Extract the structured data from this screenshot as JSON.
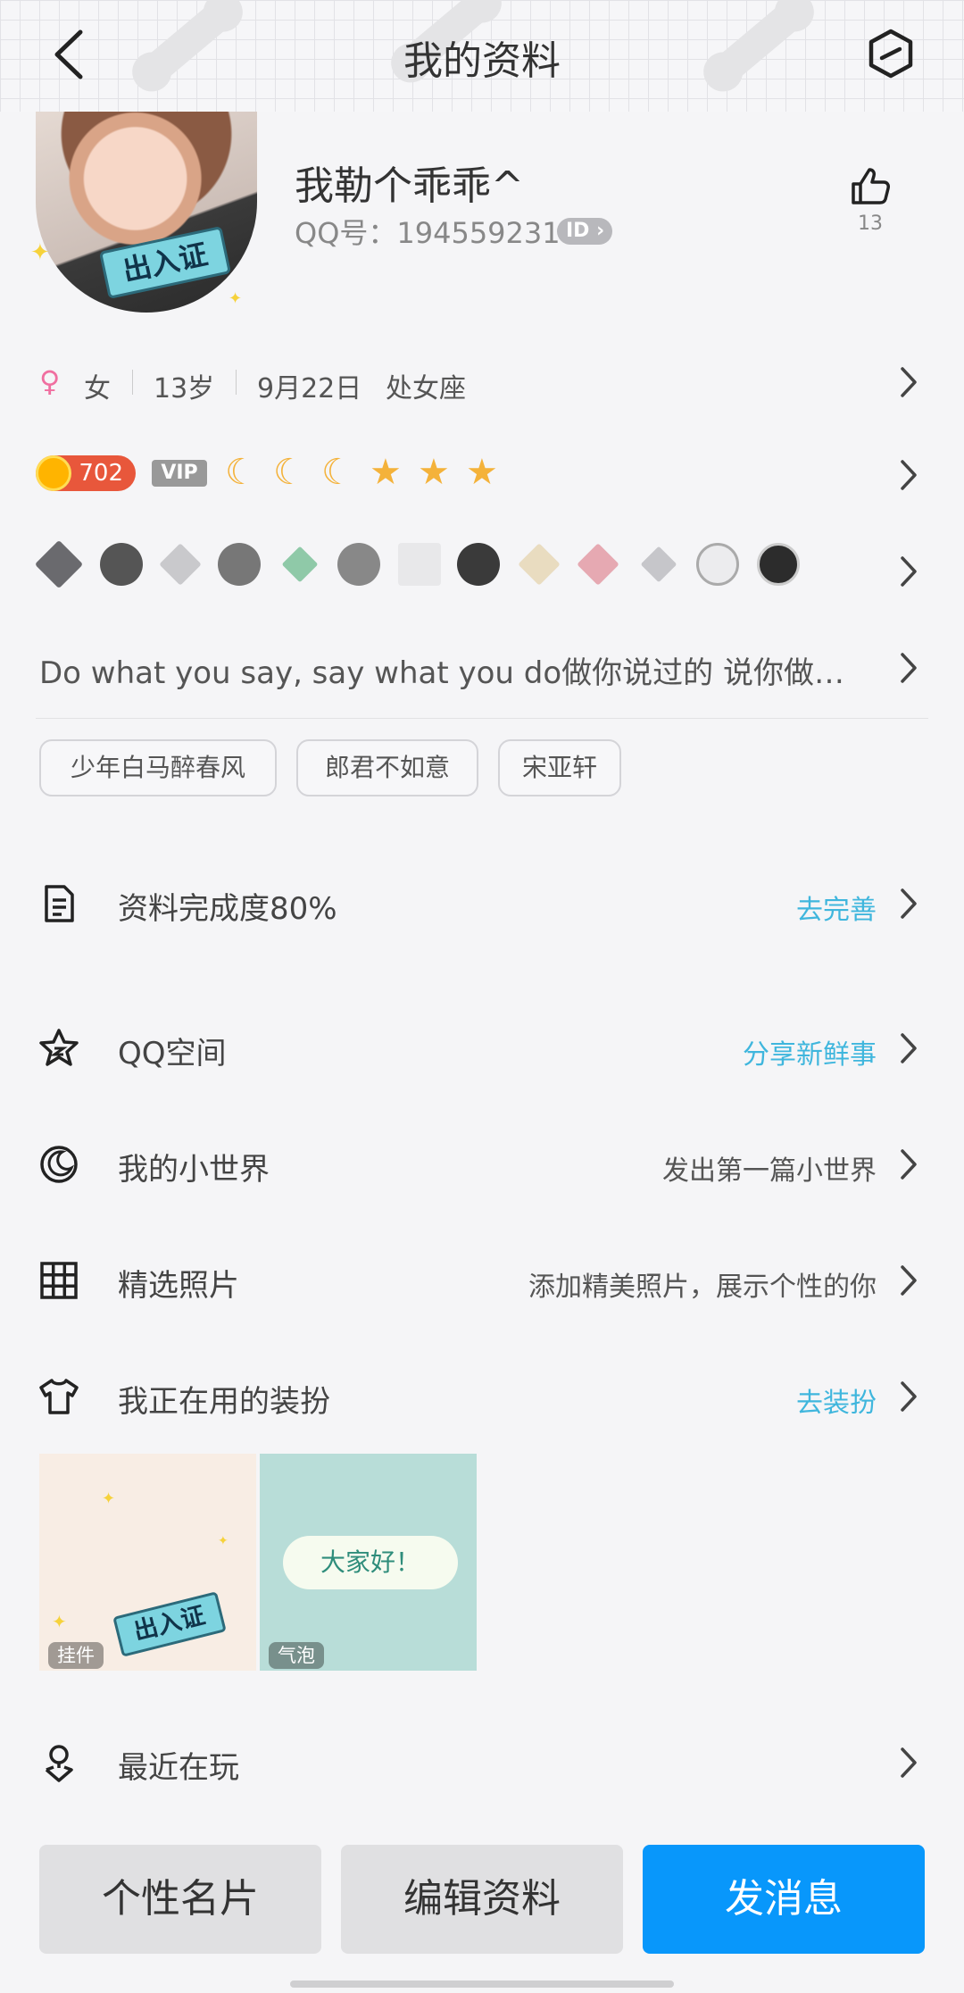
{
  "header": {
    "title": "我的资料"
  },
  "profile": {
    "avatar_badge_text": "出入证",
    "nickname": "我勒个乖乖^",
    "qq_label": "QQ号：194559231",
    "id_badge": "ID",
    "like_count": "13"
  },
  "info": {
    "gender_symbol": "♀",
    "gender": "女",
    "age": "13岁",
    "birthday": "9月22日",
    "zodiac": "处女座"
  },
  "level": {
    "value": "702",
    "vip": "VIP",
    "icons": [
      "moon",
      "moon",
      "moon",
      "star",
      "star",
      "star"
    ]
  },
  "medals": {
    "count": 13
  },
  "signature": "Do what you say, say what you do做你说过的 说你做过的",
  "tags": [
    "少年白马醉春风",
    "郎君不如意",
    "宋亚轩"
  ],
  "completion": {
    "label": "资料完成度80%",
    "action": "去完善"
  },
  "menu": {
    "qzone": {
      "label": "QQ空间",
      "action": "分享新鲜事"
    },
    "world": {
      "label": "我的小世界",
      "action": "发出第一篇小世界"
    },
    "photos": {
      "label": "精选照片",
      "action": "添加精美照片，展示个性的你"
    },
    "dress": {
      "label": "我正在用的装扮",
      "action": "去装扮"
    },
    "recent": {
      "label": "最近在玩"
    }
  },
  "dress_items": [
    {
      "label": "挂件",
      "badge_text": "出入证"
    },
    {
      "label": "气泡",
      "bubble_text": "大家好！"
    }
  ],
  "buttons": {
    "card": "个性名片",
    "edit": "编辑资料",
    "message": "发消息"
  },
  "colors": {
    "accent_blue": "#0897fb",
    "link_blue": "#3fb6dd",
    "level_red": "#e8573b"
  }
}
